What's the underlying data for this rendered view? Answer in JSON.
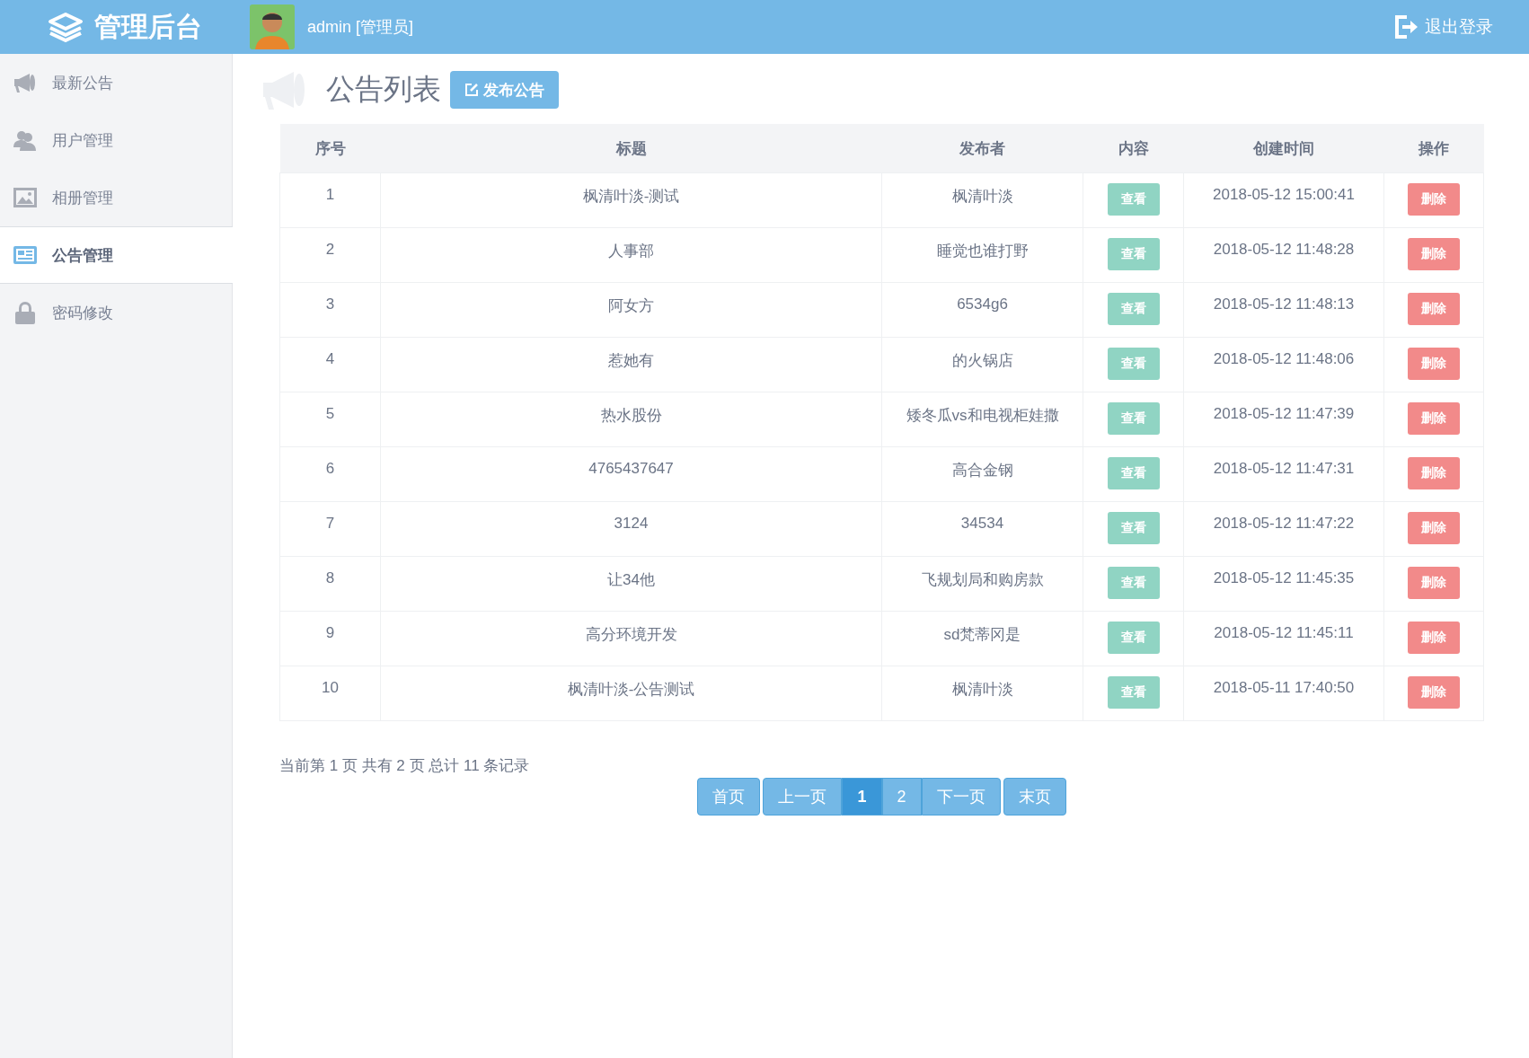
{
  "header": {
    "brand": "管理后台",
    "user": "admin [管理员]",
    "logout": "退出登录"
  },
  "sidebar": {
    "items": [
      {
        "label": "最新公告",
        "selected": false
      },
      {
        "label": "用户管理",
        "selected": false
      },
      {
        "label": "相册管理",
        "selected": false
      },
      {
        "label": "公告管理",
        "selected": true
      },
      {
        "label": "密码修改",
        "selected": false
      }
    ]
  },
  "page": {
    "title": "公告列表",
    "publish_button": "发布公告"
  },
  "table": {
    "columns": [
      "序号",
      "标题",
      "发布者",
      "内容",
      "创建时间",
      "操作"
    ],
    "rows": [
      {
        "no": "1",
        "title": "枫清叶淡-测试",
        "author": "枫清叶淡",
        "view": "查看",
        "created": "2018-05-12 15:00:41",
        "delete": "删除"
      },
      {
        "no": "2",
        "title": "人事部",
        "author": "睡觉也谁打野",
        "view": "查看",
        "created": "2018-05-12 11:48:28",
        "delete": "删除"
      },
      {
        "no": "3",
        "title": "阿女方",
        "author": "6534g6",
        "view": "查看",
        "created": "2018-05-12 11:48:13",
        "delete": "删除"
      },
      {
        "no": "4",
        "title": "惹她有",
        "author": "的火锅店",
        "view": "查看",
        "created": "2018-05-12 11:48:06",
        "delete": "删除"
      },
      {
        "no": "5",
        "title": "热水股份",
        "author": "矮冬瓜vs和电视柜娃撒",
        "view": "查看",
        "created": "2018-05-12 11:47:39",
        "delete": "删除"
      },
      {
        "no": "6",
        "title": "4765437647",
        "author": "高合金钢",
        "view": "查看",
        "created": "2018-05-12 11:47:31",
        "delete": "删除"
      },
      {
        "no": "7",
        "title": "3124",
        "author": "34534",
        "view": "查看",
        "created": "2018-05-12 11:47:22",
        "delete": "删除"
      },
      {
        "no": "8",
        "title": "让34他",
        "author": "飞规划局和购房款",
        "view": "查看",
        "created": "2018-05-12 11:45:35",
        "delete": "删除"
      },
      {
        "no": "9",
        "title": "高分环境开发",
        "author": "sd梵蒂冈是",
        "view": "查看",
        "created": "2018-05-12 11:45:11",
        "delete": "删除"
      },
      {
        "no": "10",
        "title": "枫清叶淡-公告测试",
        "author": "枫清叶淡",
        "view": "查看",
        "created": "2018-05-11 17:40:50",
        "delete": "删除"
      }
    ]
  },
  "pagination": {
    "summary": "当前第 1 页 共有 2 页 总计 11 条记录",
    "first": "首页",
    "prev": "上一页",
    "pages": [
      {
        "label": "1",
        "selected": true
      },
      {
        "label": "2",
        "selected": false
      }
    ],
    "next": "下一页",
    "last": "末页"
  }
}
